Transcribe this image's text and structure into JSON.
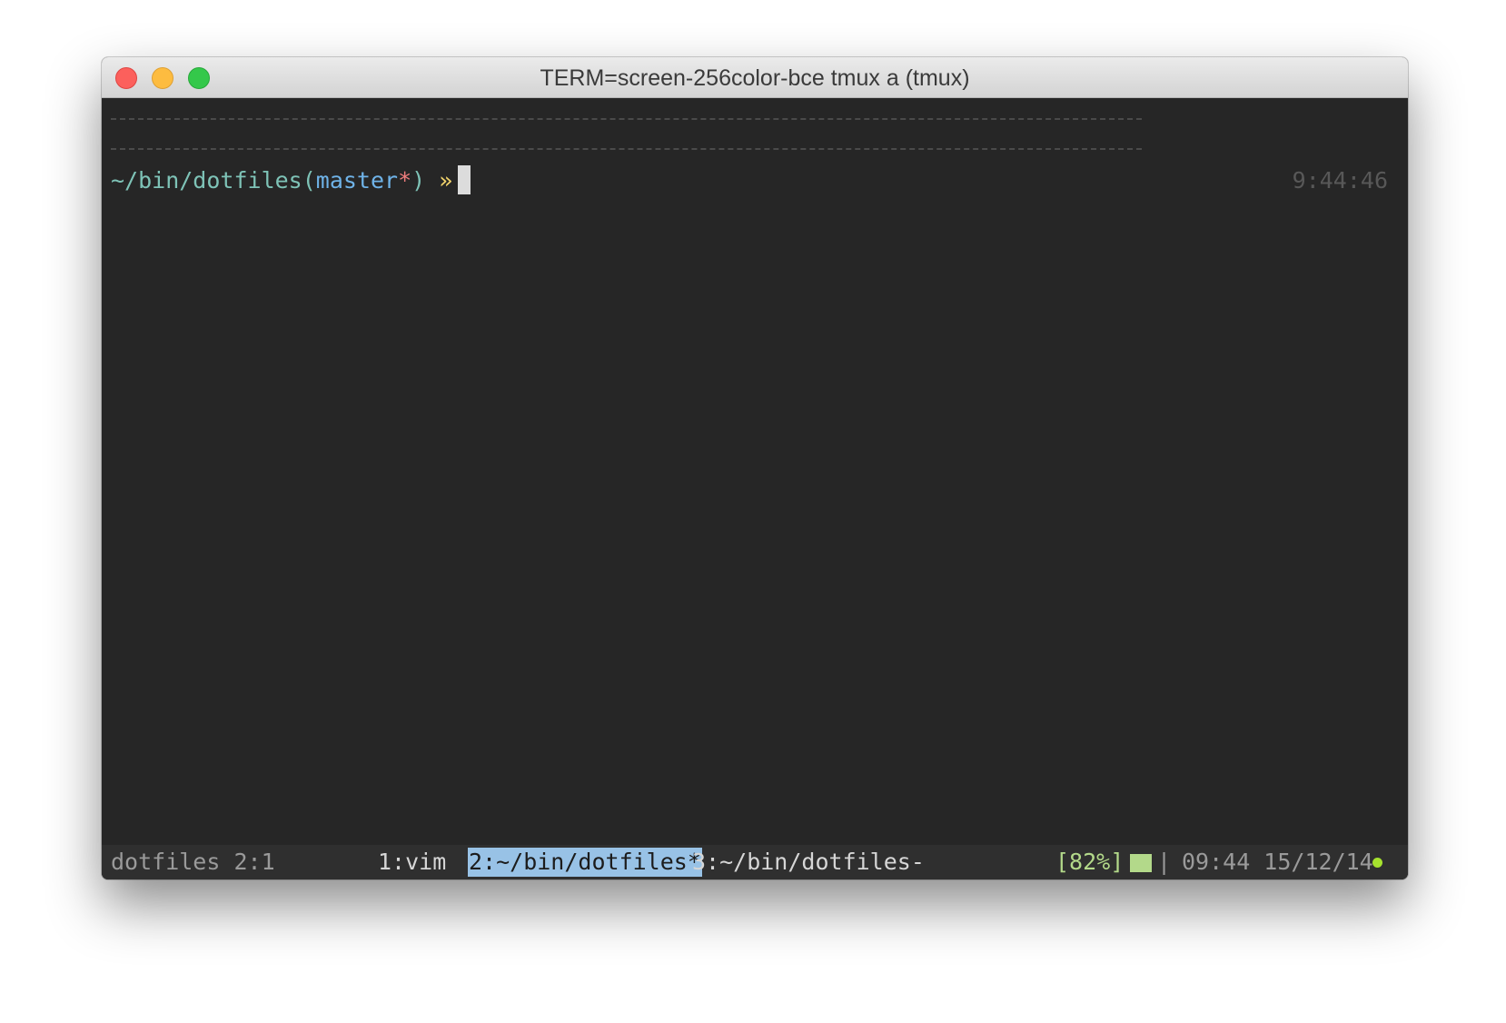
{
  "window": {
    "title": "TERM=screen-256color-bce tmux a (tmux)"
  },
  "colors": {
    "terminal_bg": "#262626",
    "path": "#7ec3b7",
    "branch": "#6fb3e8",
    "dirty_marker": "#f07d7d",
    "prompt_arrow": "#f3d46c",
    "active_window_bg": "#98c2e6",
    "battery": "#b3d98a",
    "status_dot": "#a6e22e"
  },
  "prompt": {
    "path": "~/bin/dotfiles",
    "branch_open": "(",
    "branch": "master",
    "dirty": "*",
    "branch_close": ")",
    "arrow": " »",
    "time": "9:44:46"
  },
  "statusbar": {
    "session": "dotfiles 2:1",
    "windows": [
      {
        "label": "1:vim",
        "active": false
      },
      {
        "label": "2:~/bin/dotfiles*",
        "active": true
      },
      {
        "label": "3:~/bin/dotfiles-",
        "active": false
      }
    ],
    "battery": "[82%]",
    "separator": "|",
    "clock": "09:44 15/12/14"
  }
}
